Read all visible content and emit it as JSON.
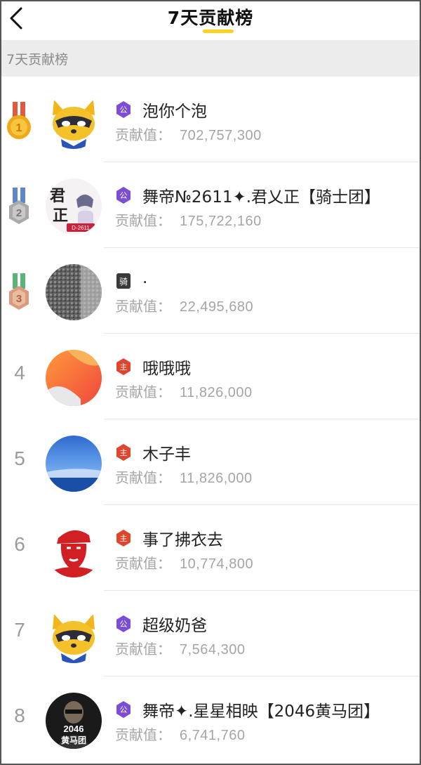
{
  "header": {
    "title": "7天贡献榜",
    "back_icon": "chevron-left-icon",
    "accent_color": "#ffd21f"
  },
  "section": {
    "label": "7天贡献榜"
  },
  "contrib_label": "贡献值：",
  "rows": [
    {
      "rank": "1",
      "medal": "gold",
      "badge": "公",
      "badge_color": "#7c4dd6",
      "name": "泡你个泡",
      "value": "702,757,300",
      "avatar": "raccoon-mascot-avatar"
    },
    {
      "rank": "2",
      "medal": "silver",
      "badge": "公",
      "badge_color": "#7c4dd6",
      "name": "舞帝№2611✦.君乂正【骑士团】",
      "value": "175,722,160",
      "avatar": "calligraphy-avatar"
    },
    {
      "rank": "3",
      "medal": "bronze",
      "badge": "骑",
      "badge_color": "#3a3a3a",
      "name": ".",
      "value": "22,495,680",
      "avatar": "gray-texture-avatar"
    },
    {
      "rank": "4",
      "medal": "",
      "badge": "主",
      "badge_color": "#e0452e",
      "name": "哦哦哦",
      "value": "11,826,000",
      "avatar": "orange-gradient-avatar"
    },
    {
      "rank": "5",
      "medal": "",
      "badge": "主",
      "badge_color": "#e0452e",
      "name": "木子丰",
      "value": "11,826,000",
      "avatar": "blue-sky-avatar"
    },
    {
      "rank": "6",
      "medal": "",
      "badge": "主",
      "badge_color": "#e0452e",
      "name": "事了拂衣去",
      "value": "10,774,800",
      "avatar": "red-portrait-avatar"
    },
    {
      "rank": "7",
      "medal": "",
      "badge": "公",
      "badge_color": "#7c4dd6",
      "name": "超级奶爸",
      "value": "7,564,300",
      "avatar": "raccoon-mascot-avatar"
    },
    {
      "rank": "8",
      "medal": "",
      "badge": "公",
      "badge_color": "#7c4dd6",
      "name": "舞帝✦.星星相映【2046黄马团】",
      "value": "6,741,760",
      "avatar": "2046-avatar"
    }
  ],
  "avatar_text": {
    "calligraphy_top": "君",
    "calligraphy_bottom": "正",
    "calligraphy_tag": "D-2611",
    "team_top": "2046",
    "team_bottom": "黄马团"
  }
}
